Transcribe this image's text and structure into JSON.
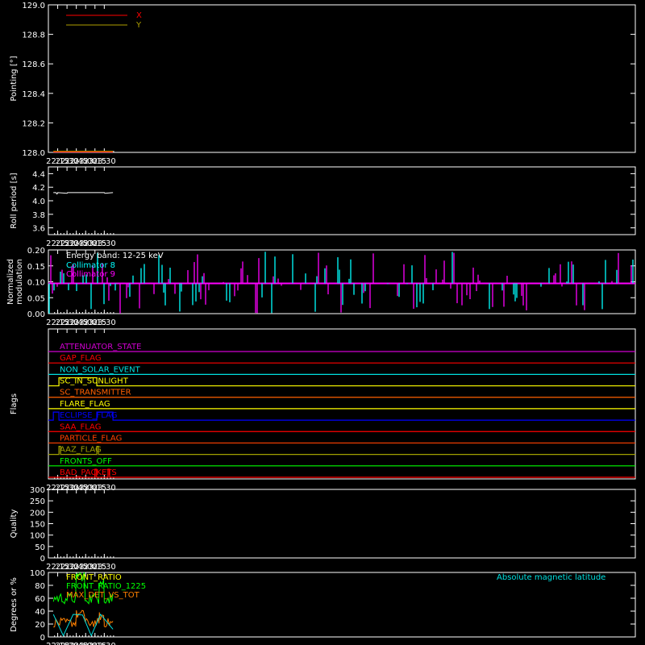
{
  "figure": {
    "background": "#000000",
    "axis_color": "#ffffff",
    "x_ticks": [
      "22:15",
      "22:30",
      "22:45",
      "23:00",
      "23:15",
      "23:30"
    ]
  },
  "chart_data": [
    {
      "type": "line",
      "id": "pointing",
      "ylabel": "Pointing [°]",
      "ylim": [
        128.0,
        129.0
      ],
      "y_ticks": [
        "128.0",
        "128.2",
        "128.4",
        "128.6",
        "128.8",
        "129.0"
      ],
      "x": [
        "22:08",
        "23:44"
      ],
      "series": [
        {
          "name": "X",
          "color": "#ff0000",
          "values": [
            128.0,
            128.0
          ]
        },
        {
          "name": "Y",
          "color": "#b0a000",
          "values": [
            128.0,
            128.0
          ]
        }
      ]
    },
    {
      "type": "line",
      "id": "roll",
      "ylabel": "Roll period [s]",
      "ylim": [
        3.5,
        4.5
      ],
      "y_ticks": [
        "3.6",
        "3.8",
        "4.0",
        "4.2",
        "4.4"
      ],
      "series": [
        {
          "name": "",
          "color": "#ffffff",
          "x": [
            "22:08",
            "22:12",
            "22:14",
            "22:15",
            "22:30",
            "22:31",
            "22:45",
            "23:00",
            "23:15",
            "23:30",
            "23:31",
            "23:44"
          ],
          "values": [
            4.12,
            4.12,
            4.1,
            4.12,
            4.11,
            4.12,
            4.12,
            4.12,
            4.12,
            4.12,
            4.11,
            4.12
          ]
        }
      ]
    },
    {
      "type": "bar",
      "id": "modulation",
      "ylabel": "Normalized modulation",
      "ylim": [
        0.0,
        0.2
      ],
      "y_ticks": [
        "0.00",
        "0.05",
        "0.10",
        "0.15",
        "0.20"
      ],
      "annotation": "Energy band: 12-25 keV",
      "baseline": 0.095,
      "series": [
        {
          "name": "Collimator 8",
          "color": "#00ffff"
        },
        {
          "name": "Collimator 9",
          "color": "#ff00ff"
        }
      ]
    },
    {
      "type": "line",
      "id": "flags",
      "ylabel": "Flags",
      "series": [
        {
          "name": "ATTENUATOR_STATE",
          "color": "#d000d0",
          "segments": []
        },
        {
          "name": "GAP_FLAG",
          "color": "#ff0000",
          "segments": []
        },
        {
          "name": "NON_SOLAR_EVENT",
          "color": "#00e0e0",
          "segments": []
        },
        {
          "name": "SC_IN_SUNLIGHT",
          "color": "#ffff00",
          "segments": [
            [
              "22:17",
              "23:18"
            ]
          ]
        },
        {
          "name": "SC_TRANSMITTER",
          "color": "#ff6000",
          "segments": []
        },
        {
          "name": "FLARE_FLAG",
          "color": "#ffff00",
          "segments": []
        },
        {
          "name": "ECLIPSE_FLAG",
          "color": "#0000ff",
          "segments": [
            [
              "22:08",
              "22:17"
            ],
            [
              "23:18",
              "23:44"
            ]
          ]
        },
        {
          "name": "SAA_FLAG",
          "color": "#ff0000",
          "segments": []
        },
        {
          "name": "PARTICLE_FLAG",
          "color": "#ff4000",
          "segments": []
        },
        {
          "name": "AAZ_FLAG",
          "color": "#a0a000",
          "segments": [
            [
              "22:17",
              "22:17"
            ],
            [
              "23:18",
              "23:18"
            ]
          ]
        },
        {
          "name": "FRONTS_OFF",
          "color": "#00ff00",
          "segments": []
        },
        {
          "name": "BAD_PACKETS",
          "color": "#ff0000",
          "segments": [
            [
              "23:15",
              "23:15"
            ],
            [
              "23:36",
              "23:36"
            ]
          ]
        }
      ]
    },
    {
      "type": "line",
      "id": "quality",
      "ylabel": "Quality",
      "ylim": [
        0,
        300
      ],
      "y_ticks": [
        "0",
        "50",
        "100",
        "150",
        "200",
        "250",
        "300"
      ],
      "series": []
    },
    {
      "type": "line",
      "id": "ratios",
      "ylabel": "Degrees or %",
      "ylim": [
        0,
        100
      ],
      "y_ticks": [
        "0",
        "20",
        "40",
        "60",
        "80",
        "100"
      ],
      "series": [
        {
          "name": "FRONT_RATIO",
          "color": "#ffff00",
          "note": "not visible"
        },
        {
          "name": "FRONT_RATIO_1225",
          "color": "#00ff00",
          "x": [
            "22:08",
            "22:44",
            "22:45",
            "22:58",
            "22:59",
            "23:21",
            "23:22",
            "23:29",
            "23:30",
            "23:44"
          ],
          "values": [
            60,
            60,
            95,
            95,
            60,
            60,
            85,
            85,
            60,
            60
          ]
        },
        {
          "name": "MAX_DET_VS_TOT",
          "color": "#ff8000",
          "x": [
            "22:08",
            "22:44",
            "22:45",
            "22:58",
            "22:59",
            "23:21",
            "23:22",
            "23:29",
            "23:30",
            "23:44"
          ],
          "values": [
            22,
            22,
            35,
            35,
            22,
            22,
            32,
            32,
            22,
            22
          ]
        },
        {
          "name": "Absolute magnetic latitude",
          "color": "#00e0e0",
          "x": [
            "22:08",
            "22:24",
            "22:40",
            "22:55",
            "23:09",
            "23:24",
            "23:44"
          ],
          "values": [
            35,
            2,
            35,
            34,
            2,
            35,
            12
          ]
        }
      ]
    }
  ]
}
